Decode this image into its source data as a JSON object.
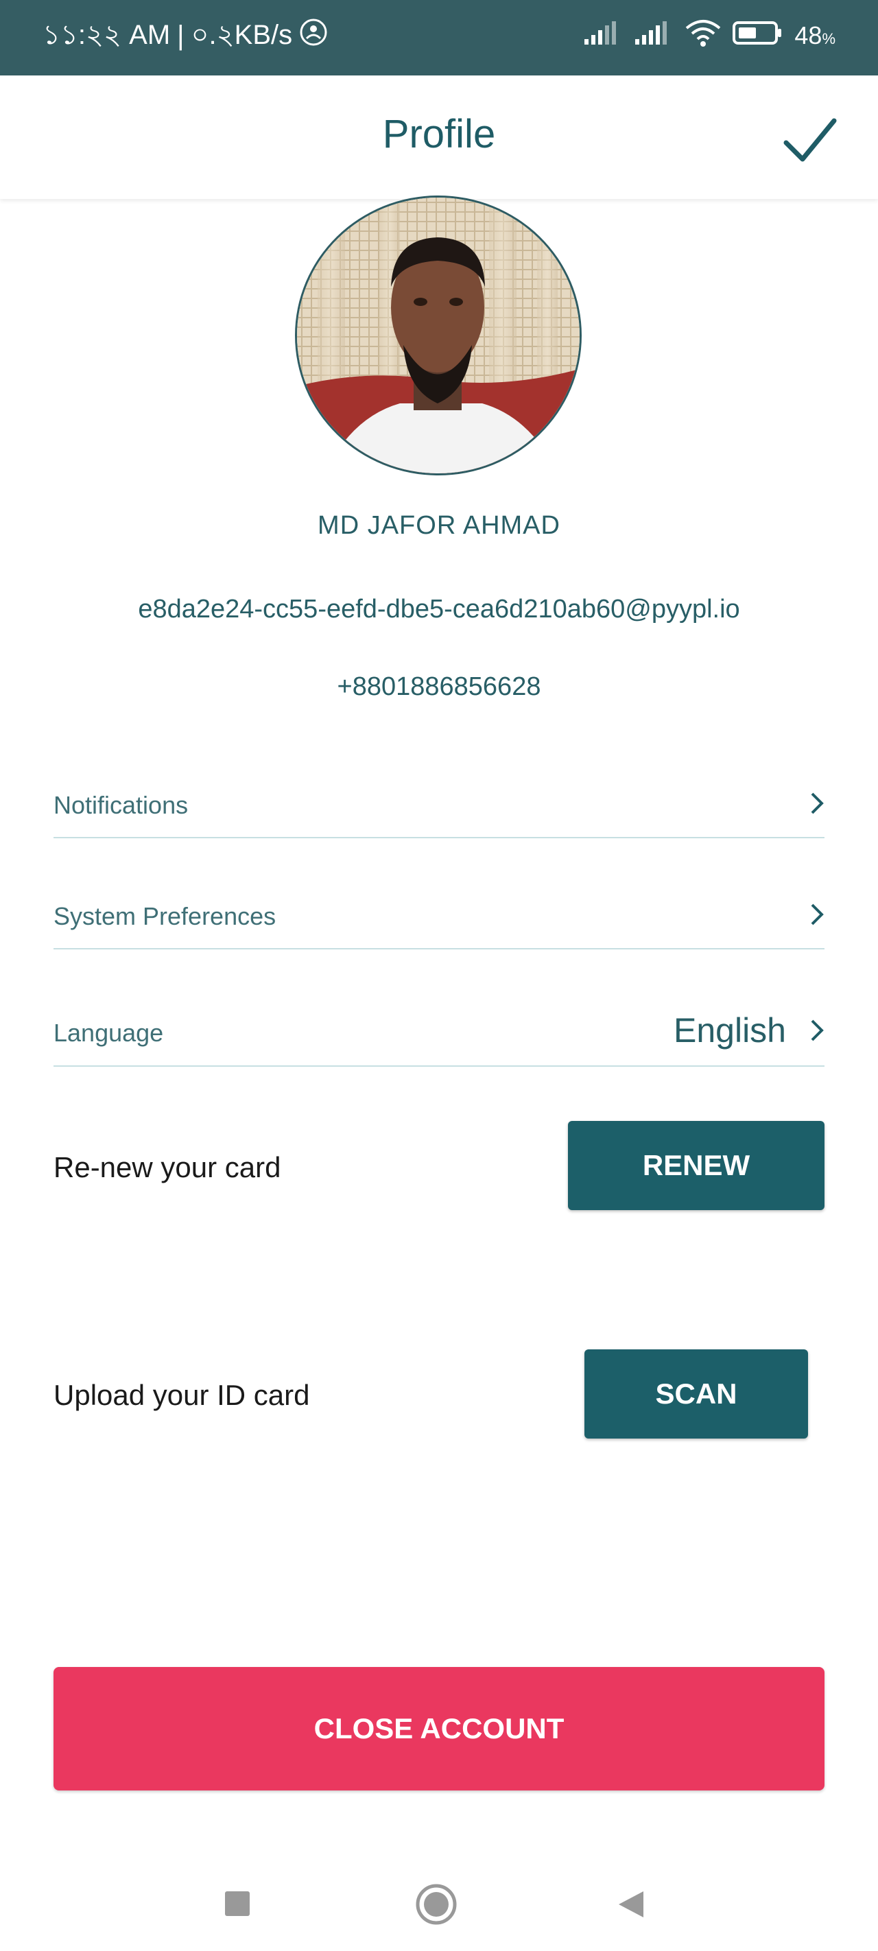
{
  "status_bar": {
    "time": "১১:২২ AM",
    "speed": "০.২KB/s",
    "battery": "48",
    "battery_unit": "%",
    "battery_level": 0.48
  },
  "header": {
    "title": "Profile"
  },
  "profile": {
    "name": "MD JAFOR AHMAD",
    "email": "e8da2e24-cc55-eefd-dbe5-cea6d210ab60@pyypl.io",
    "phone": "+8801886856628"
  },
  "settings": {
    "notifications": "Notifications",
    "system_preferences": "System Preferences",
    "language_label": "Language",
    "language_value": "English"
  },
  "actions": {
    "renew_label": "Re-new your card",
    "renew_button": "RENEW",
    "upload_label": "Upload your ID card",
    "scan_button": "SCAN",
    "close_button": "CLOSE ACCOUNT"
  },
  "colors": {
    "status_bar": "#355d63",
    "primary": "#1c5f69",
    "text": "#285e66",
    "danger": "#ea385f"
  }
}
